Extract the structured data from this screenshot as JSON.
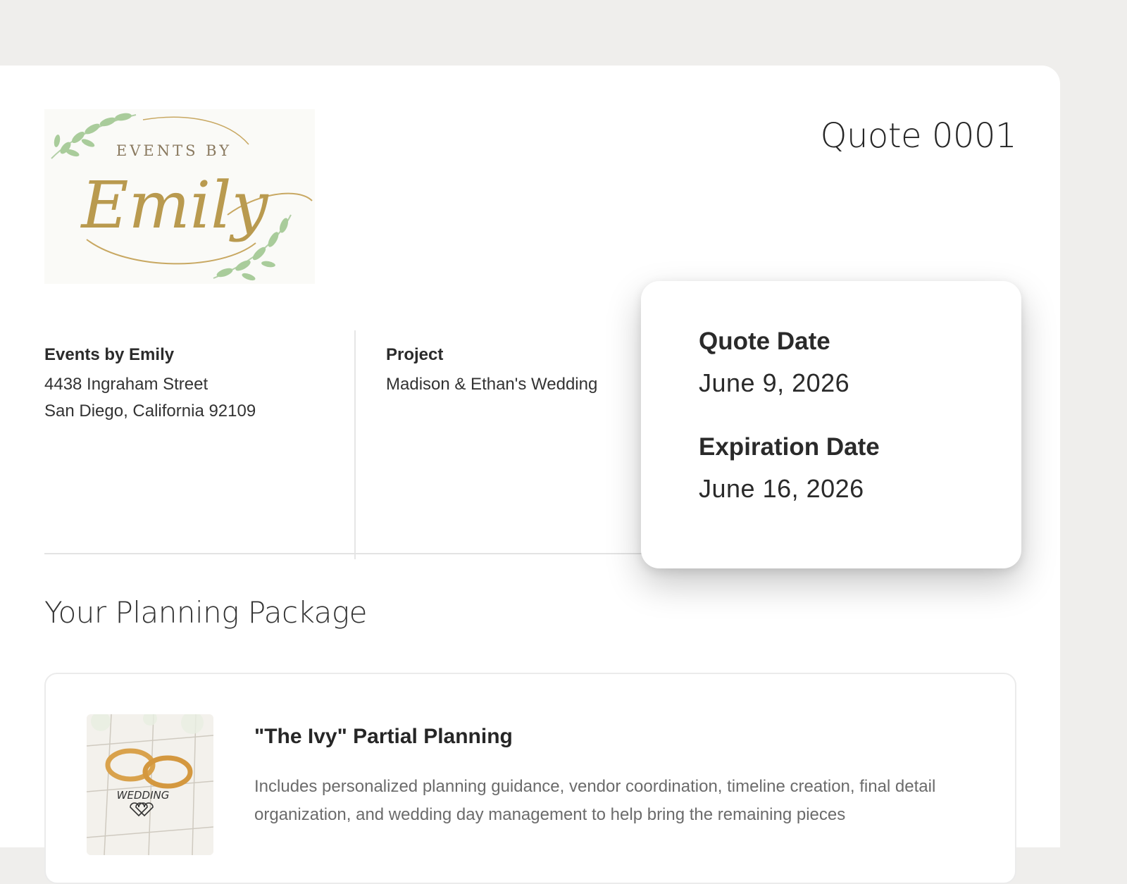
{
  "quote": {
    "number_label": "Quote 0001"
  },
  "logo": {
    "small_text": "EVENTS BY",
    "script_text": "Emily"
  },
  "company": {
    "name": "Events by Emily",
    "address_line1": "4438 Ingraham Street",
    "address_line2": "San Diego, California 92109"
  },
  "project": {
    "label": "Project",
    "name": "Madison & Ethan's Wedding"
  },
  "dates": {
    "quote_date_label": "Quote Date",
    "quote_date": "June 9, 2026",
    "expiration_label": "Expiration Date",
    "expiration_date": "June 16, 2026"
  },
  "package_section": {
    "title": "Your Planning Package",
    "item": {
      "title": "\"The Ivy\" Partial Planning",
      "description": "Includes personalized planning guidance, vendor coordination, timeline creation, final detail organization, and wedding day management to help bring the remaining pieces",
      "image_text": "WEDDING"
    }
  }
}
